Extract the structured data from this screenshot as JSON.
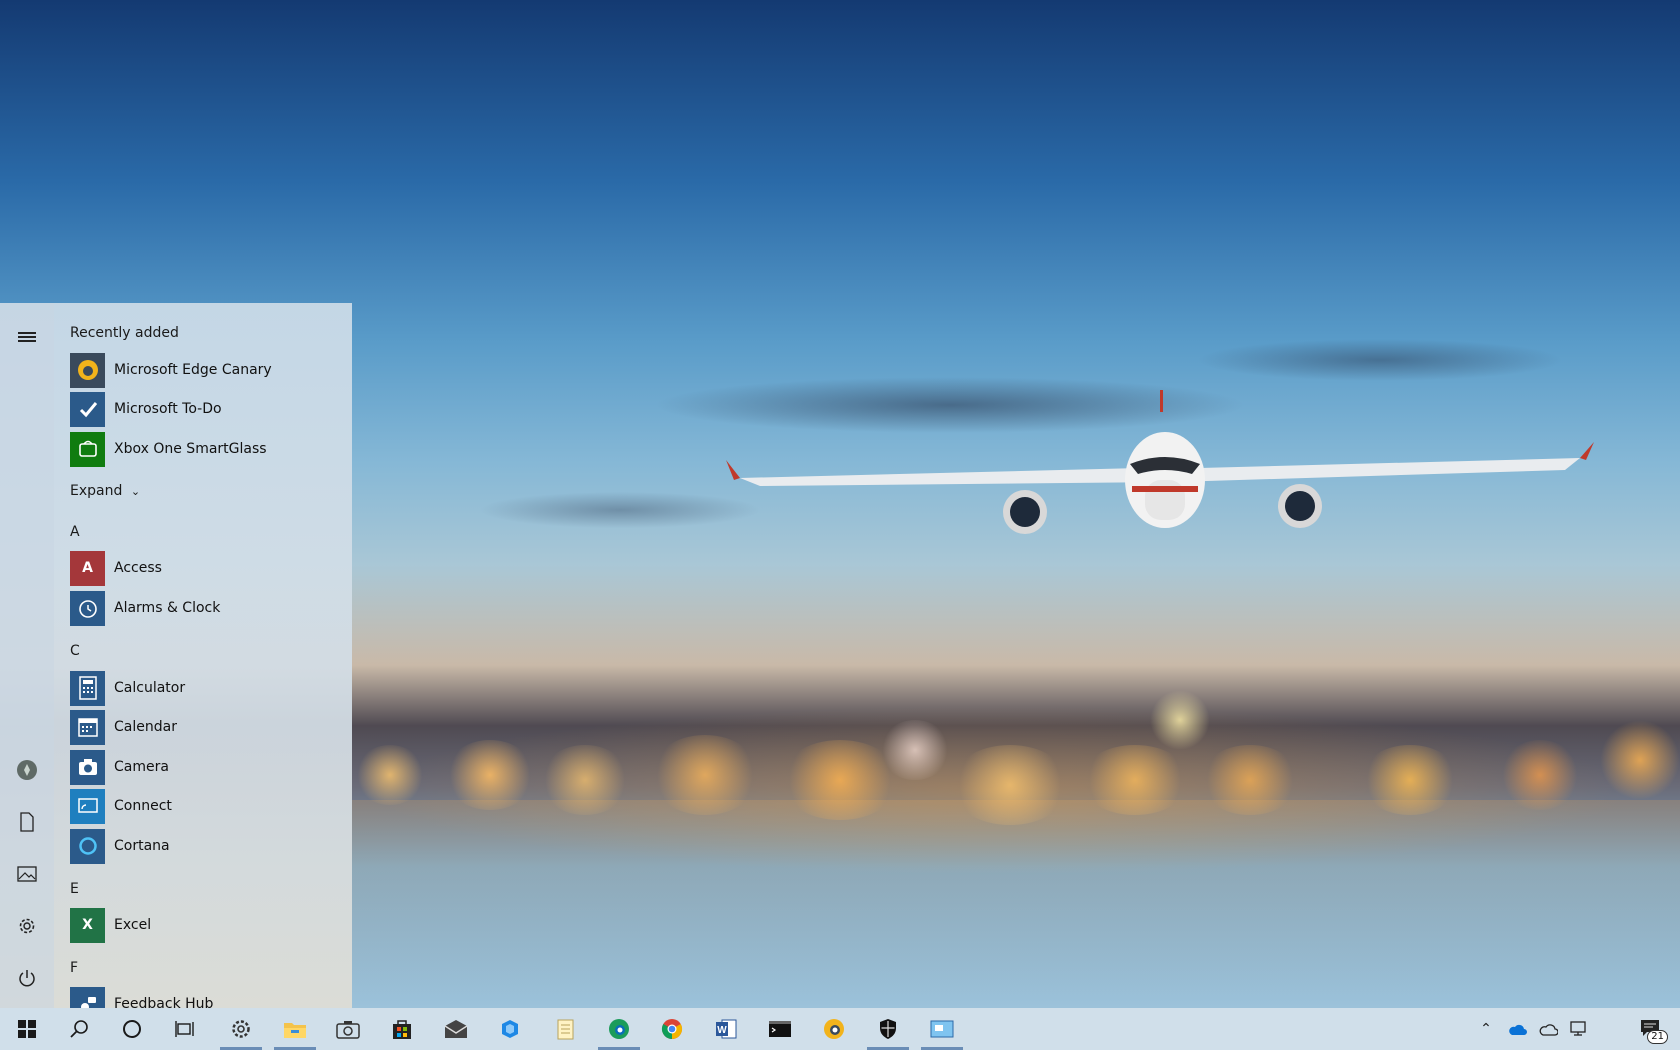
{
  "start_menu": {
    "recently_added_header": "Recently added",
    "recent_apps": [
      {
        "label": "Microsoft Edge Canary",
        "icon": "edge-canary-icon",
        "color": "#3a4a5c"
      },
      {
        "label": "Microsoft To-Do",
        "icon": "todo-check-icon",
        "color": "#2b5a8a"
      },
      {
        "label": "Xbox One SmartGlass",
        "icon": "xbox-smartglass-icon",
        "color": "#107c10"
      }
    ],
    "expand_label": "Expand",
    "groups": [
      {
        "letter": "A",
        "apps": [
          {
            "label": "Access",
            "icon": "access-icon",
            "color": "#a4373a"
          },
          {
            "label": "Alarms & Clock",
            "icon": "alarm-clock-icon",
            "color": "#2b5a8a"
          }
        ]
      },
      {
        "letter": "C",
        "apps": [
          {
            "label": "Calculator",
            "icon": "calculator-icon",
            "color": "#2b5a8a"
          },
          {
            "label": "Calendar",
            "icon": "calendar-icon",
            "color": "#2b5a8a"
          },
          {
            "label": "Camera",
            "icon": "camera-icon",
            "color": "#2b5a8a"
          },
          {
            "label": "Connect",
            "icon": "connect-icon",
            "color": "#1f7fbf"
          },
          {
            "label": "Cortana",
            "icon": "cortana-icon",
            "color": "#2b5a8a"
          }
        ]
      },
      {
        "letter": "E",
        "apps": [
          {
            "label": "Excel",
            "icon": "excel-icon",
            "color": "#217346"
          }
        ]
      },
      {
        "letter": "F",
        "apps": [
          {
            "label": "Feedback Hub",
            "icon": "feedback-hub-icon",
            "color": "#2b5a8a"
          }
        ]
      }
    ]
  },
  "taskbar": {
    "apps": [
      {
        "name": "settings",
        "icon": "gear-icon",
        "running": true
      },
      {
        "name": "file-explorer",
        "icon": "folder-icon",
        "running": true
      },
      {
        "name": "camera",
        "icon": "camera-icon",
        "running": false
      },
      {
        "name": "store",
        "icon": "store-icon",
        "running": false
      },
      {
        "name": "mail",
        "icon": "mail-icon",
        "running": false
      },
      {
        "name": "azure",
        "icon": "azure-icon",
        "running": false
      },
      {
        "name": "notepad",
        "icon": "notepad-icon",
        "running": false
      },
      {
        "name": "edge-dev",
        "icon": "edge-dev-icon",
        "running": true
      },
      {
        "name": "chrome",
        "icon": "chrome-icon",
        "running": false
      },
      {
        "name": "word",
        "icon": "word-icon",
        "running": false
      },
      {
        "name": "terminal",
        "icon": "terminal-icon",
        "running": false
      },
      {
        "name": "edge-canary",
        "icon": "edge-canary-icon",
        "running": false
      },
      {
        "name": "security",
        "icon": "shield-icon",
        "running": true
      },
      {
        "name": "remote-desktop",
        "icon": "remote-desktop-icon",
        "running": true
      }
    ],
    "notification_count": "21",
    "colors": {
      "accent": "#6a8db6",
      "taskbar": "#cedee9"
    }
  }
}
